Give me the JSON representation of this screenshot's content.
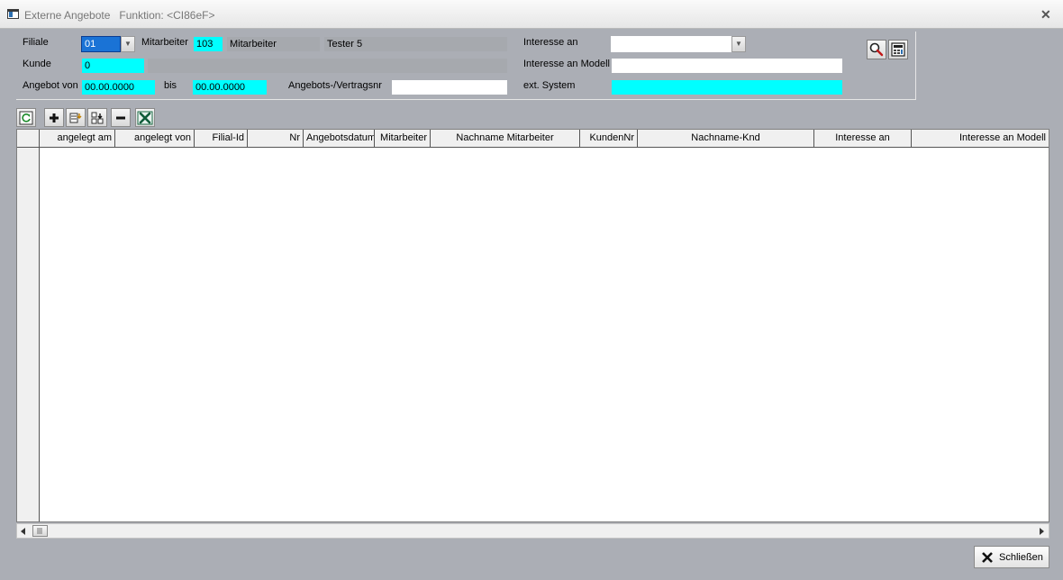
{
  "window": {
    "title": "Externe Angebote   Funktion: <CI86eF>",
    "close_glyph": "✕"
  },
  "filters": {
    "filiale_label": "Filiale",
    "filiale_value": "01",
    "mitarbeiter_label": "Mitarbeiter",
    "mitarbeiter_nr": "103",
    "mitarbeiter_type": "Mitarbeiter",
    "mitarbeiter_name": "Tester 5",
    "kunde_label": "Kunde",
    "kunde_value": "0",
    "kunde_name": "",
    "angebot_von_label": "Angebot von",
    "angebot_von_value": "00.00.0000",
    "bis_label": "bis",
    "bis_value": "00.00.0000",
    "vertragsnr_label": "Angebots-/Vertragsnr",
    "vertragsnr_value": "",
    "interesse_an_label": "Interesse an",
    "interesse_an_value": "",
    "interesse_modell_label": "Interesse an Modell",
    "interesse_modell_value": "",
    "ext_system_label": "ext. System",
    "ext_system_value": ""
  },
  "toolbar": {
    "icons": [
      "refresh-icon",
      "add-icon",
      "copy-record-icon",
      "move-record-icon",
      "remove-icon",
      "excel-export-icon"
    ]
  },
  "grid": {
    "columns": [
      "angelegt am",
      "angelegt von",
      "Filial-Id",
      "Nr",
      "Angebotsdatum",
      "Mitarbeiter",
      "Nachname Mitarbeiter",
      "KundenNr",
      "Nachname-Knd",
      "Interesse an",
      "Interesse an Modell"
    ],
    "rows": []
  },
  "footer": {
    "close_label": "Schließen"
  },
  "colors": {
    "required_field": "#00ffff",
    "selected_field": "#1a73d6",
    "window_bg": "#abaeb5"
  }
}
